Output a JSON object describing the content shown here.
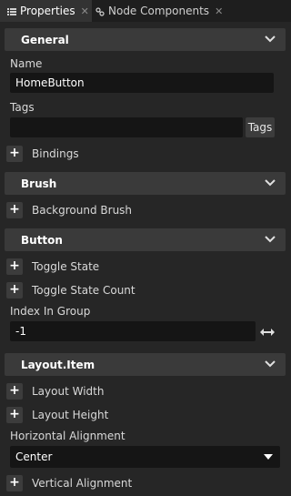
{
  "tabs": [
    {
      "label": "Properties",
      "icon": "list-icon",
      "active": true
    },
    {
      "label": "Node Components",
      "icon": "components-icon",
      "active": false
    }
  ],
  "sections": {
    "general": {
      "title": "General"
    },
    "brush": {
      "title": "Brush"
    },
    "button": {
      "title": "Button"
    },
    "layout_item": {
      "title": "Layout.Item"
    }
  },
  "general": {
    "name_label": "Name",
    "name_value": "HomeButton",
    "tags_label": "Tags",
    "tags_value": "",
    "tags_button": "Tags",
    "bindings": "Bindings"
  },
  "brush": {
    "background_brush": "Background Brush"
  },
  "button": {
    "toggle_state": "Toggle State",
    "toggle_state_count": "Toggle State Count",
    "index_label": "Index In Group",
    "index_value": "-1"
  },
  "layout_item": {
    "layout_width": "Layout Width",
    "layout_height": "Layout Height",
    "horizontal_alignment_label": "Horizontal Alignment",
    "horizontal_alignment_value": "Center",
    "vertical_alignment": "Vertical Alignment"
  },
  "colors": {
    "panel_bg": "#262626",
    "header_bg": "#3a3a3a",
    "field_bg": "#151515",
    "button_bg": "#3c3c3c",
    "tab_active_bg": "#333333"
  }
}
